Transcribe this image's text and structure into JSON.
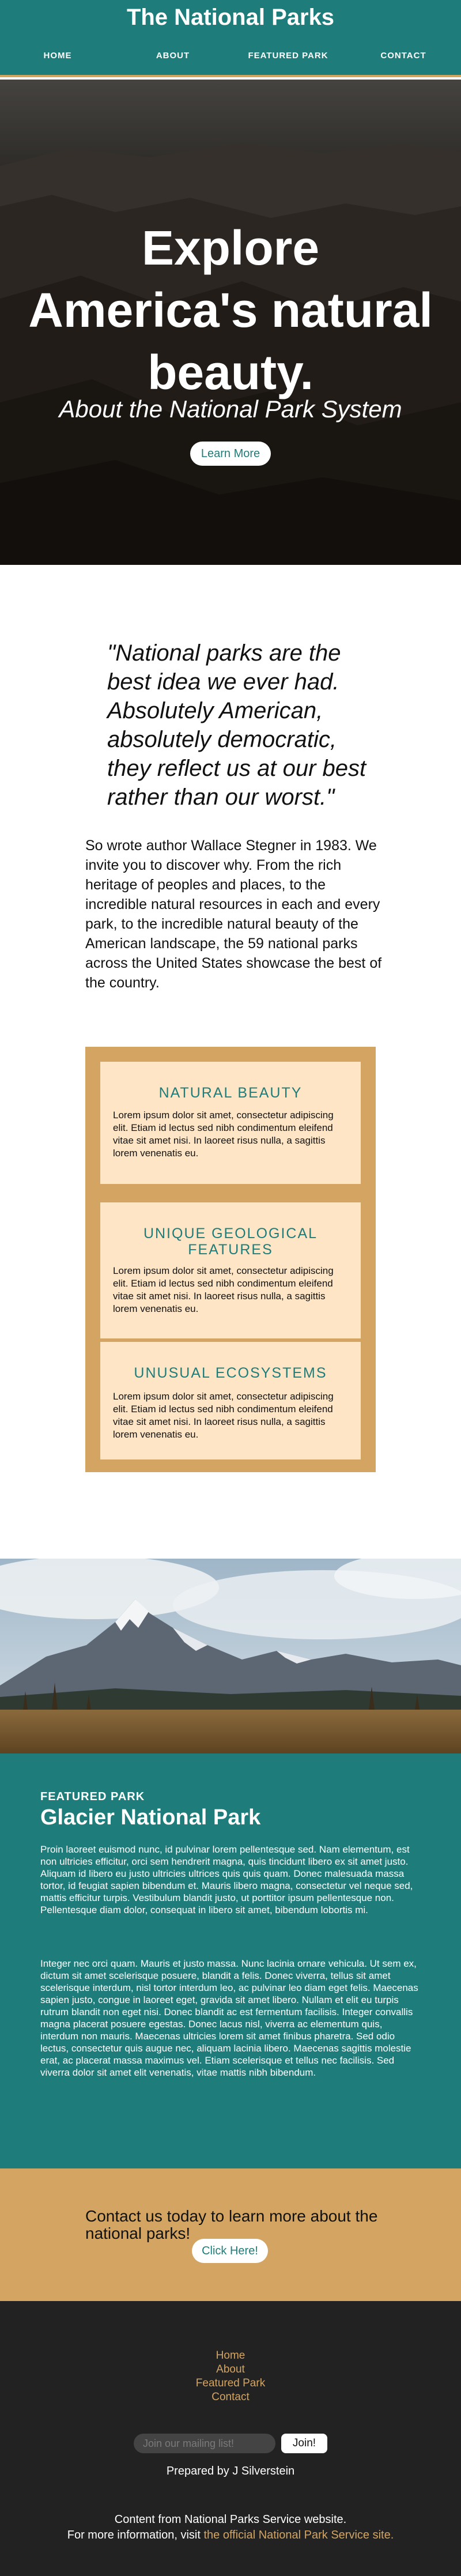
{
  "site": {
    "title": "The National Parks"
  },
  "nav": {
    "items": [
      "HOME",
      "ABOUT",
      "FEATURED PARK",
      "CONTACT"
    ]
  },
  "hero": {
    "headline": "Explore America's natural beauty.",
    "subtitle": "About the National Park System",
    "button_label": "Learn More"
  },
  "quote": {
    "text": "\"National parks are the best idea we ever had. Absolutely American, absolutely democratic, they reflect us at our best rather than our worst.\""
  },
  "intro": {
    "text": "So wrote author Wallace Stegner in 1983. We invite you to discover why. From the rich heritage of peoples and places, to the incredible natural resources in each and every park, to the incredible natural beauty of the American landscape, the 59 national parks across the United States showcase the best of the country."
  },
  "features": [
    {
      "title": "NATURAL BEAUTY",
      "text": "Lorem ipsum dolor sit amet, consectetur adipiscing elit. Etiam id lectus sed nibh condimentum eleifend vitae sit amet nisi. In laoreet risus nulla, a sagittis lorem venenatis eu."
    },
    {
      "title": "UNIQUE GEOLOGICAL FEATURES",
      "text": "Lorem ipsum dolor sit amet, consectetur adipiscing elit. Etiam id lectus sed nibh condimentum eleifend vitae sit amet nisi. In laoreet risus nulla, a sagittis lorem venenatis eu."
    },
    {
      "title": "UNUSUAL ECOSYSTEMS",
      "text": "Lorem ipsum dolor sit amet, consectetur adipiscing elit. Etiam id lectus sed nibh condimentum eleifend vitae sit amet nisi. In laoreet risus nulla, a sagittis lorem venenatis eu."
    }
  ],
  "featured_park": {
    "label": "FEATURED PARK",
    "title": "Glacier National Park",
    "paragraphs": [
      "Proin laoreet euismod nunc, id pulvinar lorem pellentesque sed. Nam elementum, est non ultricies efficitur, orci sem hendrerit magna, quis tincidunt libero ex sit amet justo. Aliquam id libero eu justo ultricies ultrices quis quis quam. Donec malesuada massa tortor, id feugiat sapien bibendum et. Mauris libero magna, consectetur vel neque sed, mattis efficitur turpis. Vestibulum blandit justo, ut porttitor ipsum pellentesque non. Pellentesque diam dolor, consequat in libero sit amet, bibendum lobortis mi.",
      "Integer nec orci quam. Mauris et justo massa. Nunc lacinia ornare vehicula. Ut sem ex, dictum sit amet scelerisque posuere, blandit a felis. Donec viverra, tellus sit amet scelerisque interdum, nisl tortor interdum leo, ac pulvinar leo diam eget felis. Maecenas sapien justo, congue in laoreet eget, gravida sit amet libero. Nullam et elit eu turpis rutrum blandit non eget nisi. Donec blandit ac est fermentum facilisis. Integer convallis magna placerat posuere egestas. Donec lacus nisl, viverra ac elementum quis, interdum non mauris. Maecenas ultricies lorem sit amet finibus pharetra. Sed odio lectus, consectetur quis augue nec, aliquam lacinia libero. Maecenas sagittis molestie erat, ac placerat massa maximus vel. Etiam scelerisque et tellus nec facilisis. Sed viverra dolor sit amet elit venenatis, vitae mattis nibh bibendum."
    ]
  },
  "contact": {
    "text": "Contact us today to learn more about the national parks!",
    "button_label": "Click Here!"
  },
  "footer": {
    "links": [
      "Home",
      "About",
      "Featured Park",
      "Contact"
    ],
    "subscribe_placeholder": "Join our mailing list!",
    "subscribe_button": "Join!",
    "prepared_by": "Prepared by J Silverstein",
    "content_from": "Content from National Parks Service website.",
    "more_info_prefix": "For more information, visit ",
    "more_info_link": "the official National Park Service site."
  },
  "colors": {
    "teal": "#1e7d7a",
    "gold": "#d4a562",
    "card": "#fde5c6",
    "footer": "#222222"
  }
}
